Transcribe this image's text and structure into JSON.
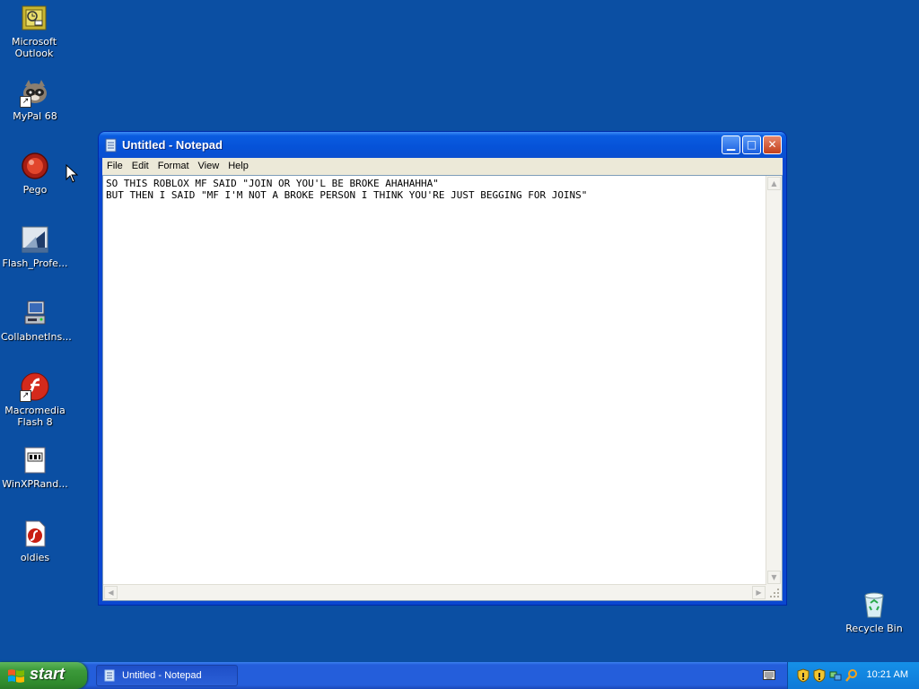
{
  "desktop": {
    "icons": [
      {
        "label": "Microsoft\nOutlook",
        "icon": "outlook-icon"
      },
      {
        "label": "MyPal 68",
        "icon": "mypal-icon"
      },
      {
        "label": "Pego",
        "icon": "pego-icon"
      },
      {
        "label": "Flash_Profe...",
        "icon": "flash-pro-icon"
      },
      {
        "label": "CollabnetIns...",
        "icon": "installer-icon"
      },
      {
        "label": "Macromedia\nFlash 8",
        "icon": "macromedia-flash-icon"
      },
      {
        "label": "WinXPRand...",
        "icon": "winxprand-icon"
      },
      {
        "label": "oldies",
        "icon": "oldies-icon"
      }
    ],
    "recycle_bin": {
      "label": "Recycle Bin",
      "icon": "recycle-bin-icon"
    }
  },
  "notepad": {
    "title": "Untitled - Notepad",
    "menu": [
      "File",
      "Edit",
      "Format",
      "View",
      "Help"
    ],
    "content": "SO THIS ROBLOX MF SAID \"JOIN OR YOU'L BE BROKE AHAHAHHA\"\nBUT THEN I SAID \"MF I'M NOT A BROKE PERSON I THINK YOU'RE JUST BEGGING FOR JOINS\"",
    "buttons": {
      "minimize": "minimize-icon",
      "maximize": "maximize-icon",
      "close": "close-icon"
    }
  },
  "taskbar": {
    "start_label": "start",
    "task_label": "Untitled - Notepad",
    "clock": "10:21 AM"
  },
  "colors": {
    "desktop_bg": "#0b4fa3",
    "titlebar": "#0a5ce0",
    "start_green": "#3c9a3a",
    "tray_blue": "#0f7ad8"
  }
}
